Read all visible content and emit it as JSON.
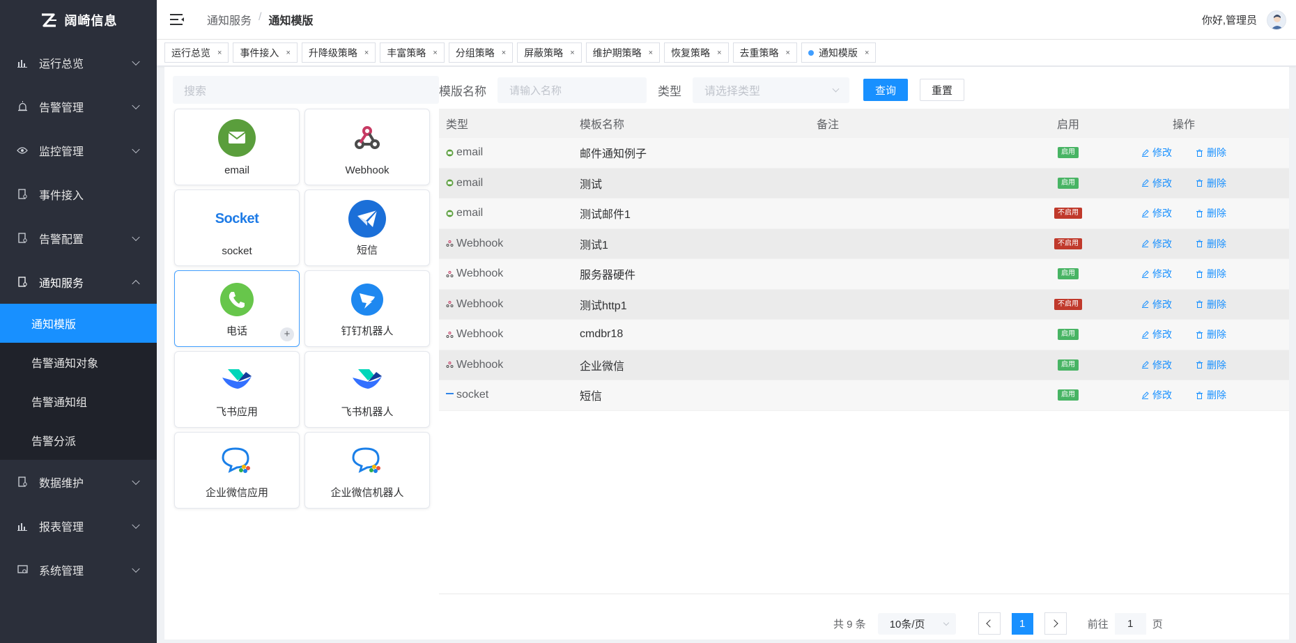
{
  "app": {
    "name": "阔崎信息"
  },
  "sidebar": {
    "items": [
      {
        "label": "运行总览"
      },
      {
        "label": "告警管理"
      },
      {
        "label": "监控管理"
      },
      {
        "label": "事件接入"
      },
      {
        "label": "告警配置"
      },
      {
        "label": "通知服务"
      },
      {
        "label": "数据维护"
      },
      {
        "label": "报表管理"
      },
      {
        "label": "系统管理"
      }
    ],
    "submenu": [
      {
        "label": "通知模版"
      },
      {
        "label": "告警通知对象"
      },
      {
        "label": "告警通知组"
      },
      {
        "label": "告警分派"
      }
    ]
  },
  "header": {
    "breadcrumb": [
      "通知服务",
      "/",
      "通知模版"
    ],
    "greeting": "你好,管理员"
  },
  "tags": [
    {
      "label": "运行总览"
    },
    {
      "label": "事件接入"
    },
    {
      "label": "升降级策略"
    },
    {
      "label": "丰富策略"
    },
    {
      "label": "分组策略"
    },
    {
      "label": "屏蔽策略"
    },
    {
      "label": "维护期策略"
    },
    {
      "label": "恢复策略"
    },
    {
      "label": "去重策略"
    },
    {
      "label": "通知模版"
    }
  ],
  "tag_close": "×",
  "left": {
    "search_placeholder": "搜索",
    "socket_logo_text": "Socket",
    "cards": [
      {
        "label": "email"
      },
      {
        "label": "Webhook"
      },
      {
        "label": "socket"
      },
      {
        "label": "短信"
      },
      {
        "label": "电话"
      },
      {
        "label": "钉钉机器人"
      },
      {
        "label": "飞书应用"
      },
      {
        "label": "飞书机器人"
      },
      {
        "label": "企业微信应用"
      },
      {
        "label": "企业微信机器人"
      }
    ],
    "plus": "+"
  },
  "filter": {
    "name_label": "模版名称",
    "name_placeholder": "请输入名称",
    "type_label": "类型",
    "type_placeholder": "请选择类型",
    "query": "查询",
    "reset": "重置"
  },
  "table": {
    "headers": [
      "类型",
      "模板名称",
      "备注",
      "启用",
      "操作"
    ],
    "edit": "修改",
    "delete": "删除",
    "rows": [
      {
        "type": "email",
        "name": "邮件通知例子",
        "note": "",
        "status": "启用",
        "enabled": true
      },
      {
        "type": "email",
        "name": "测试",
        "note": "",
        "status": "启用",
        "enabled": true
      },
      {
        "type": "email",
        "name": "测试邮件1",
        "note": "",
        "status": "不启用",
        "enabled": false
      },
      {
        "type": "Webhook",
        "name": "测试1",
        "note": "",
        "status": "不启用",
        "enabled": false
      },
      {
        "type": "Webhook",
        "name": "服务器硬件",
        "note": "",
        "status": "启用",
        "enabled": true
      },
      {
        "type": "Webhook",
        "name": "测试http1",
        "note": "",
        "status": "不启用",
        "enabled": false
      },
      {
        "type": "Webhook",
        "name": "cmdbr18",
        "note": "",
        "status": "启用",
        "enabled": true
      },
      {
        "type": "Webhook",
        "name": "企业微信",
        "note": "",
        "status": "启用",
        "enabled": true
      },
      {
        "type": "socket",
        "name": "短信",
        "note": "",
        "status": "启用",
        "enabled": true
      }
    ]
  },
  "pager": {
    "total": "共 9 条",
    "page_size": "10条/页",
    "current": "1",
    "goto_label": "前往",
    "goto_value": "1",
    "page_suffix": "页"
  },
  "colors": {
    "accent": "#1890ff",
    "sidebar_bg": "#2b2f3a",
    "enabled": "#48b464",
    "disabled": "#c0392b"
  }
}
